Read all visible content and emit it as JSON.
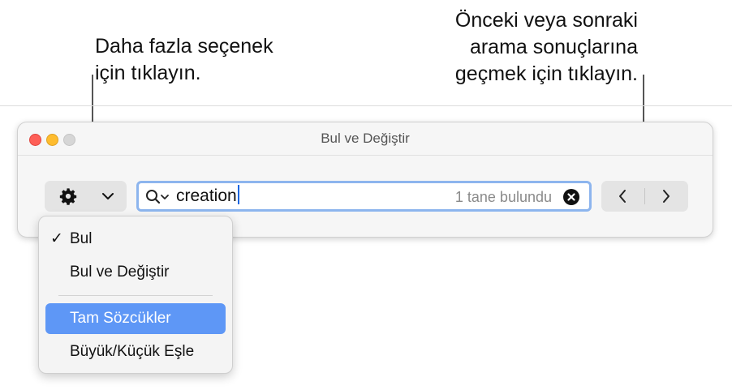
{
  "callouts": {
    "left": {
      "line1": "Daha fazla seçenek",
      "line2": "için tıklayın."
    },
    "right": {
      "line1": "Önceki veya sonraki",
      "line2": "arama sonuçlarına",
      "line3": "geçmek için tıklayın."
    }
  },
  "window": {
    "title": "Bul ve Değiştir"
  },
  "toolbar": {
    "gear_icon": "gear-icon",
    "dropdown_icon": "chevron-down-icon",
    "search": {
      "value": "creation",
      "match_count": "1 tane bulundu"
    },
    "nav_prev_icon": "chevron-left-icon",
    "nav_next_icon": "chevron-right-icon"
  },
  "menu": {
    "items": [
      {
        "label": "Bul",
        "checked": true,
        "highlighted": false
      },
      {
        "label": "Bul ve Değiştir",
        "checked": false,
        "highlighted": false
      },
      {
        "label": "Tam Sözcükler",
        "checked": false,
        "highlighted": true
      },
      {
        "label": "Büyük/Küçük Eşle",
        "checked": false,
        "highlighted": false
      }
    ],
    "check_mark": "✓"
  },
  "colors": {
    "focus_ring": "#8db5ee",
    "menu_highlight": "#5e97f6",
    "traffic_close": "#fe5f57",
    "traffic_minimize": "#febc2e",
    "traffic_zoom": "#d6d6d6"
  }
}
